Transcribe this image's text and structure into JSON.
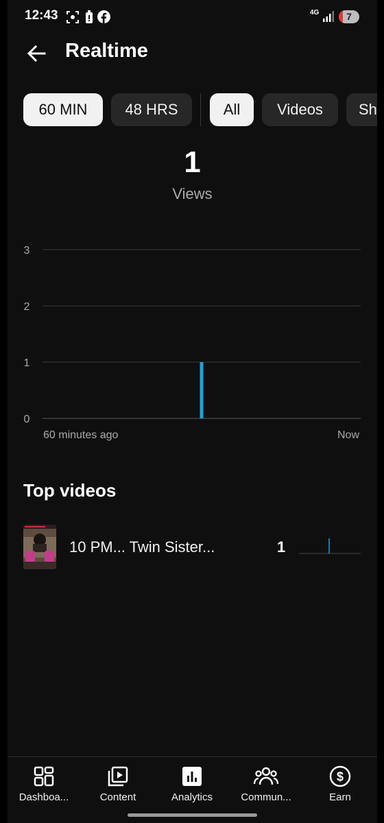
{
  "status_bar": {
    "time": "12:43",
    "network": "4G",
    "battery": "7"
  },
  "header": {
    "title": "Realtime"
  },
  "time_filters": [
    {
      "label": "60 MIN",
      "selected": true
    },
    {
      "label": "48 HRS",
      "selected": false
    }
  ],
  "type_filters": [
    {
      "label": "All",
      "selected": true
    },
    {
      "label": "Videos",
      "selected": false
    },
    {
      "label": "Sh",
      "selected": false
    }
  ],
  "metric": {
    "value": "1",
    "label": "Views"
  },
  "chart_data": {
    "type": "bar",
    "x_start_label": "60 minutes ago",
    "x_end_label": "Now",
    "yticks": [
      "0",
      "1",
      "2",
      "3"
    ],
    "ylim": [
      0,
      3
    ],
    "x_range_minutes": [
      -60,
      0
    ],
    "bars": [
      {
        "x_minutes": -30,
        "value": 1
      }
    ],
    "grid": true,
    "bar_color": "#1aa3d9"
  },
  "top_videos": {
    "title": "Top videos",
    "items": [
      {
        "title": "10 PM... Twin Sister...",
        "views": "1"
      }
    ]
  },
  "bottom_nav": [
    {
      "label": "Dashboa...",
      "icon": "dashboard-icon"
    },
    {
      "label": "Content",
      "icon": "content-icon"
    },
    {
      "label": "Analytics",
      "icon": "analytics-icon"
    },
    {
      "label": "Commun...",
      "icon": "community-icon"
    },
    {
      "label": "Earn",
      "icon": "earn-icon"
    }
  ],
  "colors": {
    "accent": "#1aa3d9",
    "background": "#0f0f0f",
    "chip": "#272727"
  }
}
